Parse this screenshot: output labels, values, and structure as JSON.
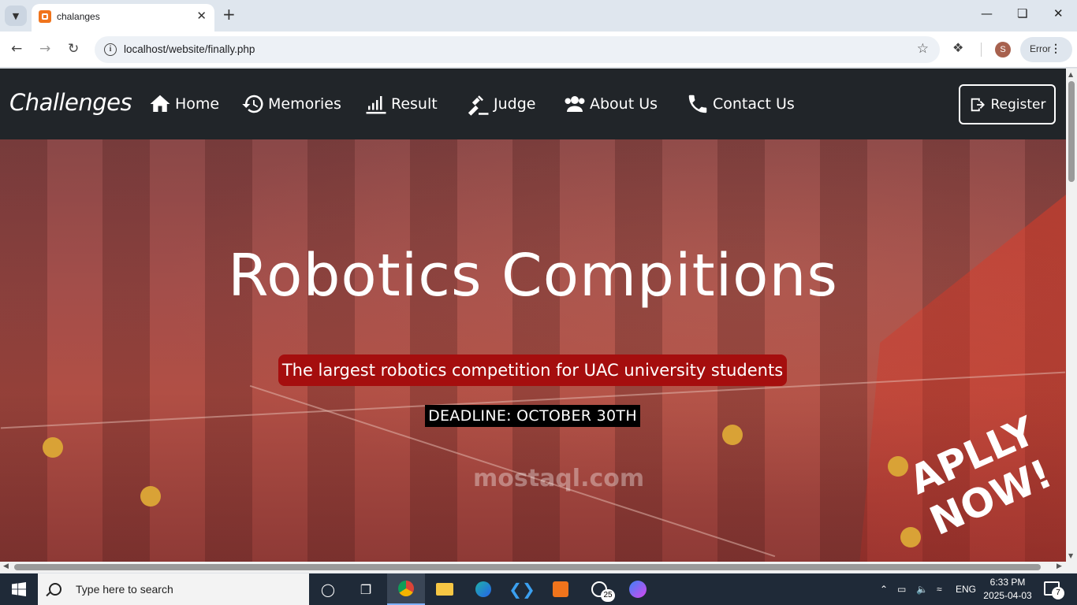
{
  "browser": {
    "tab_title": "chalanges",
    "url": "localhost/website/finally.php",
    "profile_initial": "S",
    "error_label": "Error"
  },
  "site": {
    "brand": "Challenges",
    "nav": [
      {
        "label": "Home",
        "icon": "home-icon"
      },
      {
        "label": "Memories",
        "icon": "history-icon"
      },
      {
        "label": "Result",
        "icon": "chart-hand-icon"
      },
      {
        "label": "Judge",
        "icon": "gavel-icon"
      },
      {
        "label": "About Us",
        "icon": "users-icon"
      },
      {
        "label": "Contact Us",
        "icon": "phone-icon"
      }
    ],
    "register_label": "Register"
  },
  "hero": {
    "title": "Robotics Compitions",
    "tagline": "The largest robotics competition for UAC university students",
    "deadline": "DEADLINE: OCTOBER 30TH",
    "apply_line1": "APLLY",
    "apply_line2": "NOW!"
  },
  "watermark": "mostaql.com",
  "taskbar": {
    "search_placeholder": "Type here to search",
    "whatsapp_badge": "25",
    "language": "ENG",
    "time": "6:33 PM",
    "date": "2025-04-03",
    "notification_count": "7"
  },
  "colors": {
    "site_nav_bg": "#212529",
    "tagline_bg": "#a50e0e",
    "deadline_bg": "#000000",
    "hero_overlay": "#a34e4a"
  }
}
